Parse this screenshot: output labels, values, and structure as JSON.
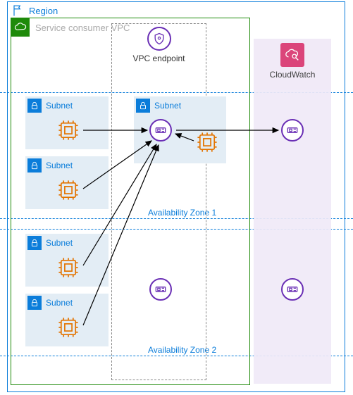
{
  "region": {
    "label": "Region"
  },
  "vpc": {
    "label": "Service consumer VPC"
  },
  "endpoint": {
    "label": "VPC endpoint"
  },
  "cloudwatch": {
    "label": "CloudWatch"
  },
  "az1": {
    "label": "Availability Zone 1"
  },
  "az2": {
    "label": "Availability Zone 2"
  },
  "subnets": {
    "s1": "Subnet",
    "s2": "Subnet",
    "s3": "Subnet",
    "s4": "Subnet",
    "s5": "Subnet"
  },
  "icons": {
    "flag": "region-flag-icon",
    "cloud": "vpc-cloud-icon",
    "lock": "subnet-lock-icon",
    "chip": "compute-chip-icon",
    "shield": "endpoint-shield-icon",
    "magnifier": "cloudwatch-magnifier-icon",
    "eni": "network-interface-icon"
  },
  "colors": {
    "region_border": "#0b7dda",
    "vpc_border": "#1e8a0a",
    "subnet_bg": "#e3edf5",
    "purple": "#6a2fb5",
    "orange": "#e37400",
    "cloudwatch_bg": "#f0e9f7",
    "cloudwatch_badge": "#d9366f"
  },
  "arrows": [
    {
      "from": "chip-s1",
      "to": "eni-az1"
    },
    {
      "from": "chip-s2",
      "to": "eni-az1"
    },
    {
      "from": "chip-s3",
      "to": "eni-az1"
    },
    {
      "from": "chip-s4",
      "to": "eni-az1"
    },
    {
      "from": "chip-ep",
      "to": "eni-az1"
    },
    {
      "from": "eni-az1",
      "to": "eni-cw1"
    }
  ],
  "chart_data": {
    "type": "diagram",
    "nodes": [
      {
        "id": "region",
        "label": "Region",
        "type": "container"
      },
      {
        "id": "vpc",
        "label": "Service consumer VPC",
        "type": "container",
        "parent": "region"
      },
      {
        "id": "az1",
        "label": "Availability Zone 1",
        "type": "zone",
        "parent": "region"
      },
      {
        "id": "az2",
        "label": "Availability Zone 2",
        "type": "zone",
        "parent": "region"
      },
      {
        "id": "endpoint_lane",
        "label": "VPC endpoint",
        "type": "lane",
        "parent": "vpc"
      },
      {
        "id": "subnet1",
        "label": "Subnet",
        "type": "subnet",
        "parent": "vpc",
        "zone": "az1"
      },
      {
        "id": "subnet2",
        "label": "Subnet",
        "type": "subnet",
        "parent": "vpc",
        "zone": "az1"
      },
      {
        "id": "subnet3",
        "label": "Subnet",
        "type": "subnet",
        "parent": "vpc",
        "zone": "az2"
      },
      {
        "id": "subnet4",
        "label": "Subnet",
        "type": "subnet",
        "parent": "vpc",
        "zone": "az2"
      },
      {
        "id": "subnet5",
        "label": "Subnet",
        "type": "subnet",
        "parent": "endpoint_lane",
        "zone": "az1"
      },
      {
        "id": "instance1",
        "type": "instance",
        "parent": "subnet1"
      },
      {
        "id": "instance2",
        "type": "instance",
        "parent": "subnet2"
      },
      {
        "id": "instance3",
        "type": "instance",
        "parent": "subnet3"
      },
      {
        "id": "instance4",
        "type": "instance",
        "parent": "subnet4"
      },
      {
        "id": "instance5",
        "type": "instance",
        "parent": "subnet5"
      },
      {
        "id": "eni_az1",
        "type": "eni",
        "parent": "subnet5"
      },
      {
        "id": "eni_az2",
        "type": "eni",
        "parent": "endpoint_lane",
        "zone": "az2"
      },
      {
        "id": "cloudwatch",
        "label": "CloudWatch",
        "type": "service",
        "parent": "region"
      },
      {
        "id": "cw_eni_az1",
        "type": "eni",
        "parent": "cloudwatch",
        "zone": "az1"
      },
      {
        "id": "cw_eni_az2",
        "type": "eni",
        "parent": "cloudwatch",
        "zone": "az2"
      }
    ],
    "edges": [
      {
        "from": "instance1",
        "to": "eni_az1"
      },
      {
        "from": "instance2",
        "to": "eni_az1"
      },
      {
        "from": "instance3",
        "to": "eni_az1"
      },
      {
        "from": "instance4",
        "to": "eni_az1"
      },
      {
        "from": "instance5",
        "to": "eni_az1"
      },
      {
        "from": "eni_az1",
        "to": "cw_eni_az1"
      }
    ]
  }
}
